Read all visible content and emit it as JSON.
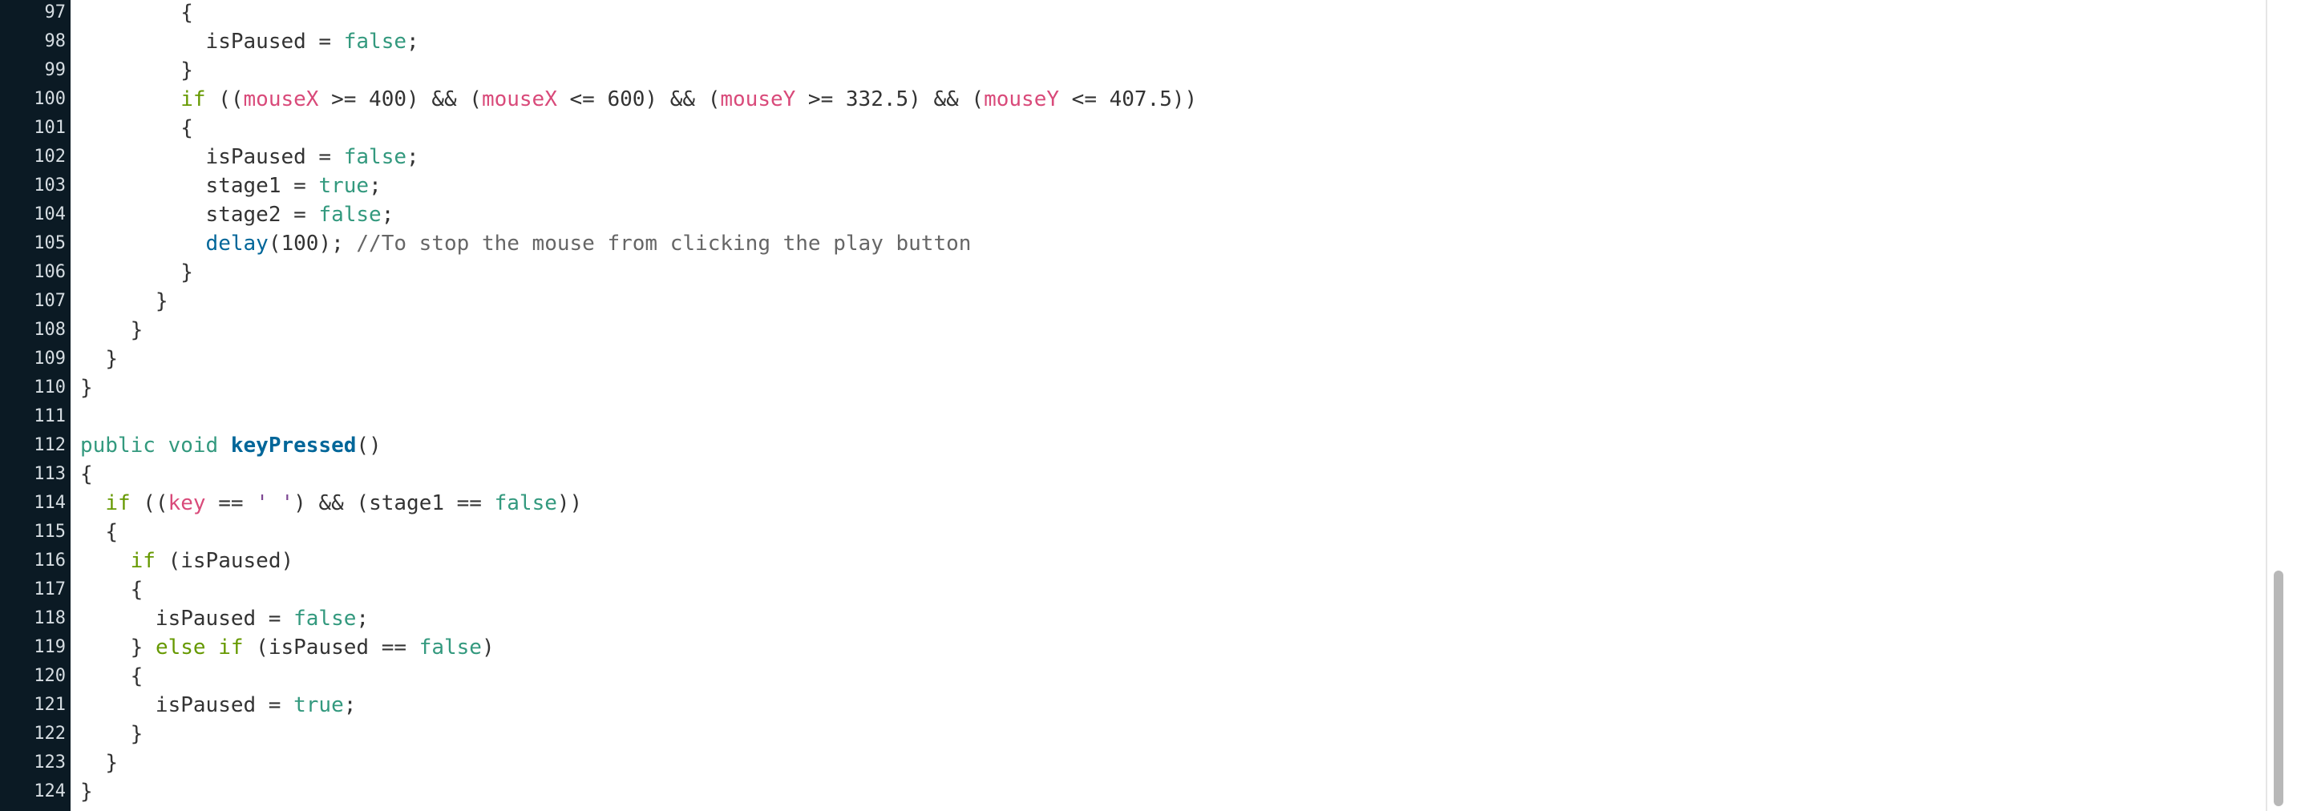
{
  "editor": {
    "colors": {
      "gutter_bg": "#0b1a24",
      "keyword": "#33997e",
      "control": "#669900",
      "variable": "#d94a7a",
      "function": "#006699",
      "comment": "#666666",
      "plain": "#333333"
    },
    "lines": [
      {
        "num": "97",
        "indent": "        ",
        "tokens": [
          {
            "t": "{",
            "c": "plain"
          }
        ]
      },
      {
        "num": "98",
        "indent": "          ",
        "tokens": [
          {
            "t": "isPaused = ",
            "c": "plain"
          },
          {
            "t": "false",
            "c": "lit"
          },
          {
            "t": ";",
            "c": "plain"
          }
        ]
      },
      {
        "num": "99",
        "indent": "        ",
        "tokens": [
          {
            "t": "}",
            "c": "plain"
          }
        ]
      },
      {
        "num": "100",
        "indent": "        ",
        "tokens": [
          {
            "t": "if",
            "c": "ctrl"
          },
          {
            "t": " ((",
            "c": "plain"
          },
          {
            "t": "mouseX",
            "c": "var"
          },
          {
            "t": " >= 400) && (",
            "c": "plain"
          },
          {
            "t": "mouseX",
            "c": "var"
          },
          {
            "t": " <= 600) && (",
            "c": "plain"
          },
          {
            "t": "mouseY",
            "c": "var"
          },
          {
            "t": " >= 332.5) && (",
            "c": "plain"
          },
          {
            "t": "mouseY",
            "c": "var"
          },
          {
            "t": " <= 407.5))",
            "c": "plain"
          }
        ]
      },
      {
        "num": "101",
        "indent": "        ",
        "tokens": [
          {
            "t": "{",
            "c": "plain"
          }
        ]
      },
      {
        "num": "102",
        "indent": "          ",
        "tokens": [
          {
            "t": "isPaused = ",
            "c": "plain"
          },
          {
            "t": "false",
            "c": "lit"
          },
          {
            "t": ";",
            "c": "plain"
          }
        ]
      },
      {
        "num": "103",
        "indent": "          ",
        "tokens": [
          {
            "t": "stage1 = ",
            "c": "plain"
          },
          {
            "t": "true",
            "c": "lit"
          },
          {
            "t": ";",
            "c": "plain"
          }
        ]
      },
      {
        "num": "104",
        "indent": "          ",
        "tokens": [
          {
            "t": "stage2 = ",
            "c": "plain"
          },
          {
            "t": "false",
            "c": "lit"
          },
          {
            "t": ";",
            "c": "plain"
          }
        ]
      },
      {
        "num": "105",
        "indent": "          ",
        "tokens": [
          {
            "t": "delay",
            "c": "fn"
          },
          {
            "t": "(100); ",
            "c": "plain"
          },
          {
            "t": "//To stop the mouse from clicking the play button",
            "c": "cmt"
          }
        ]
      },
      {
        "num": "106",
        "indent": "        ",
        "tokens": [
          {
            "t": "}",
            "c": "plain"
          }
        ]
      },
      {
        "num": "107",
        "indent": "      ",
        "tokens": [
          {
            "t": "}",
            "c": "plain"
          }
        ]
      },
      {
        "num": "108",
        "indent": "    ",
        "tokens": [
          {
            "t": "}",
            "c": "plain"
          }
        ]
      },
      {
        "num": "109",
        "indent": "  ",
        "tokens": [
          {
            "t": "}",
            "c": "plain"
          }
        ]
      },
      {
        "num": "110",
        "indent": "",
        "tokens": [
          {
            "t": "}",
            "c": "plain"
          }
        ]
      },
      {
        "num": "111",
        "indent": "",
        "tokens": []
      },
      {
        "num": "112",
        "indent": "",
        "tokens": [
          {
            "t": "public",
            "c": "kw"
          },
          {
            "t": " ",
            "c": "plain"
          },
          {
            "t": "void",
            "c": "kw"
          },
          {
            "t": " ",
            "c": "plain"
          },
          {
            "t": "keyPressed",
            "c": "fndef"
          },
          {
            "t": "()",
            "c": "plain"
          }
        ]
      },
      {
        "num": "113",
        "indent": "",
        "tokens": [
          {
            "t": "{",
            "c": "plain"
          }
        ]
      },
      {
        "num": "114",
        "indent": "  ",
        "tokens": [
          {
            "t": "if",
            "c": "ctrl"
          },
          {
            "t": " ((",
            "c": "plain"
          },
          {
            "t": "key",
            "c": "var"
          },
          {
            "t": " == ",
            "c": "plain"
          },
          {
            "t": "' '",
            "c": "str"
          },
          {
            "t": ") && (stage1 == ",
            "c": "plain"
          },
          {
            "t": "false",
            "c": "lit"
          },
          {
            "t": "))",
            "c": "plain"
          }
        ]
      },
      {
        "num": "115",
        "indent": "  ",
        "tokens": [
          {
            "t": "{",
            "c": "plain"
          }
        ]
      },
      {
        "num": "116",
        "indent": "    ",
        "tokens": [
          {
            "t": "if",
            "c": "ctrl"
          },
          {
            "t": " (isPaused)",
            "c": "plain"
          }
        ]
      },
      {
        "num": "117",
        "indent": "    ",
        "tokens": [
          {
            "t": "{",
            "c": "plain"
          }
        ]
      },
      {
        "num": "118",
        "indent": "      ",
        "tokens": [
          {
            "t": "isPaused = ",
            "c": "plain"
          },
          {
            "t": "false",
            "c": "lit"
          },
          {
            "t": ";",
            "c": "plain"
          }
        ]
      },
      {
        "num": "119",
        "indent": "    ",
        "tokens": [
          {
            "t": "} ",
            "c": "plain"
          },
          {
            "t": "else",
            "c": "ctrl"
          },
          {
            "t": " ",
            "c": "plain"
          },
          {
            "t": "if",
            "c": "ctrl"
          },
          {
            "t": " (isPaused == ",
            "c": "plain"
          },
          {
            "t": "false",
            "c": "lit"
          },
          {
            "t": ")",
            "c": "plain"
          }
        ]
      },
      {
        "num": "120",
        "indent": "    ",
        "tokens": [
          {
            "t": "{",
            "c": "plain"
          }
        ]
      },
      {
        "num": "121",
        "indent": "      ",
        "tokens": [
          {
            "t": "isPaused = ",
            "c": "plain"
          },
          {
            "t": "true",
            "c": "lit"
          },
          {
            "t": ";",
            "c": "plain"
          }
        ]
      },
      {
        "num": "122",
        "indent": "    ",
        "tokens": [
          {
            "t": "}",
            "c": "plain"
          }
        ]
      },
      {
        "num": "123",
        "indent": "  ",
        "tokens": [
          {
            "t": "}",
            "c": "plain"
          }
        ]
      },
      {
        "num": "124",
        "indent": "",
        "tokens": [
          {
            "t": "}",
            "c": "plain"
          }
        ]
      }
    ],
    "scroll_fraction": 0.78
  }
}
